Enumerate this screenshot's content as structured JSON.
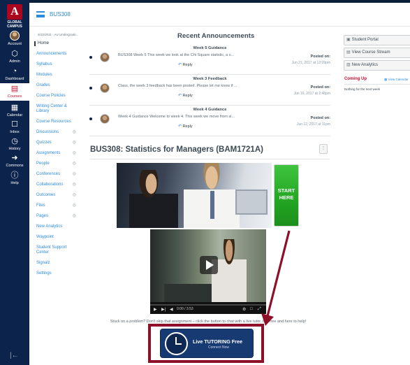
{
  "global_nav": {
    "logo_letter": "A",
    "logo_text": "GLOBAL CAMPUS",
    "items": [
      {
        "label": "Account",
        "icon": "avatar"
      },
      {
        "label": "Admin",
        "icon": "shield-icon"
      },
      {
        "label": "Dashboard",
        "icon": "dashboard-icon"
      },
      {
        "label": "Courses",
        "icon": "book-icon"
      },
      {
        "label": "Calendar",
        "icon": "calendar-icon"
      },
      {
        "label": "Inbox",
        "icon": "inbox-icon"
      },
      {
        "label": "History",
        "icon": "clock-icon"
      },
      {
        "label": "Commons",
        "icon": "commons-icon"
      },
      {
        "label": "Help",
        "icon": "help-icon"
      }
    ],
    "active": "Courses",
    "collapse_glyph": "|←"
  },
  "header": {
    "breadcrumb": "BUS308"
  },
  "course_nav": {
    "term": "5/23/2011 - AU Undergradu...",
    "items": [
      {
        "label": "Home",
        "active": true,
        "hidden": false
      },
      {
        "label": "Announcements",
        "active": false,
        "hidden": false
      },
      {
        "label": "Syllabus",
        "active": false,
        "hidden": false
      },
      {
        "label": "Modules",
        "active": false,
        "hidden": false
      },
      {
        "label": "Grades",
        "active": false,
        "hidden": false
      },
      {
        "label": "Course Policies",
        "active": false,
        "hidden": false
      },
      {
        "label": "Writing Center & Library",
        "active": false,
        "hidden": false
      },
      {
        "label": "Course Resources",
        "active": false,
        "hidden": false
      },
      {
        "label": "Discussions",
        "active": false,
        "hidden": true
      },
      {
        "label": "Quizzes",
        "active": false,
        "hidden": true
      },
      {
        "label": "Assignments",
        "active": false,
        "hidden": true
      },
      {
        "label": "People",
        "active": false,
        "hidden": true
      },
      {
        "label": "Conferences",
        "active": false,
        "hidden": true
      },
      {
        "label": "Collaborations",
        "active": false,
        "hidden": true
      },
      {
        "label": "Outcomes",
        "active": false,
        "hidden": true
      },
      {
        "label": "Files",
        "active": false,
        "hidden": true
      },
      {
        "label": "Pages",
        "active": false,
        "hidden": true
      },
      {
        "label": "New Analytics",
        "active": false,
        "hidden": false
      },
      {
        "label": "Waypoint",
        "active": false,
        "hidden": false
      },
      {
        "label": "Student Support Center",
        "active": false,
        "hidden": false
      },
      {
        "label": "Signalz",
        "active": false,
        "hidden": false
      },
      {
        "label": "Settings",
        "active": false,
        "hidden": false
      }
    ]
  },
  "announcements": {
    "title": "Recent Announcements",
    "items": [
      {
        "heading": "Week 5 Guidance",
        "body": "BUS308 Week 5   This week we look at the Chi Square statistic, a s...",
        "reply": "Reply",
        "posted_label": "Posted on:",
        "date": "Jun 21, 2017 at 12:09pm"
      },
      {
        "heading": "Week 3 Feedback",
        "body": "Class, the week 3 feedback has been posted.  Please let me know if ...",
        "reply": "Reply",
        "posted_label": "Posted on:",
        "date": "Jun 16, 2017 at 2:48pm"
      },
      {
        "heading": "Week 4 Guidance",
        "body": "Week 4 Guidance Welcome to week 4. This week we move from si...",
        "reply": "Reply",
        "posted_label": "Posted on:",
        "date": "Jun 12, 2017 at 11pm"
      }
    ]
  },
  "course": {
    "title": "BUS308: Statistics for Managers (BAM1721A)",
    "start_button": "START HERE",
    "video_time": "0:00 / 3:53",
    "video_progress": 0.0,
    "stuck_text": "Stuck on a problem? Don't skip that assignment – click the button to chat with a live tutor. It is free and here to help!",
    "tutor_label": "Live TUTORING Free",
    "tutor_sub": "Connect Now"
  },
  "sidebar": {
    "buttons": [
      {
        "label": "Student Portal",
        "icon": "portal-icon"
      },
      {
        "label": "View Course Stream",
        "icon": "stream-icon"
      },
      {
        "label": "New Analytics",
        "icon": "analytics-icon"
      }
    ],
    "coming_up": "Coming Up",
    "view_calendar": "View Calendar",
    "nothing": "Nothing for the next week"
  },
  "colors": {
    "brand_navy": "#0c234b",
    "brand_red": "#ab0520",
    "link_blue": "#2d8ce0",
    "annotation_red": "#8e1028"
  }
}
